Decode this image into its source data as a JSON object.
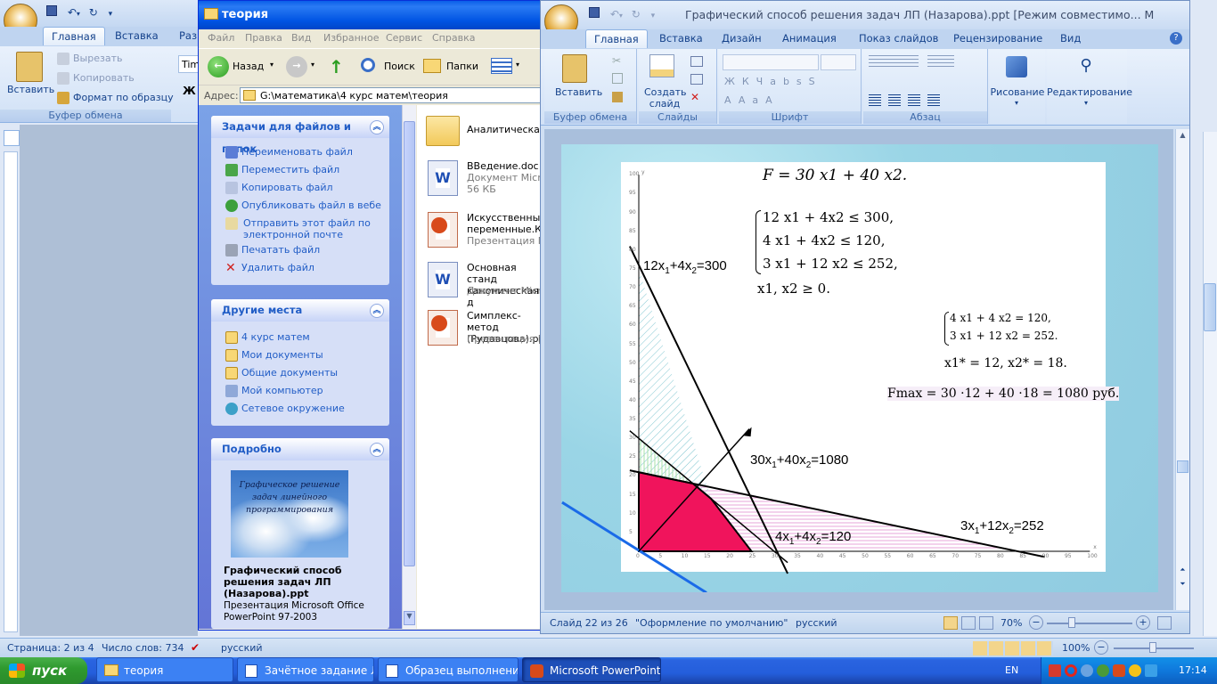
{
  "word": {
    "tabs": [
      "Главная",
      "Вставка",
      "Раз"
    ],
    "clipboard": {
      "paste": "Вставить",
      "cut": "Вырезать",
      "copy": "Копировать",
      "format_painter": "Формат по образцу",
      "group": "Буфер обмена"
    },
    "font_box": "Tim",
    "status": {
      "page": "Страница: 2 из 4",
      "words": "Число слов: 734",
      "lang": "русский",
      "zoom": "100%"
    }
  },
  "explorer": {
    "title": "теория",
    "menu": [
      "Файл",
      "Правка",
      "Вид",
      "Избранное",
      "Сервис",
      "Справка"
    ],
    "toolbar": {
      "back": "Назад",
      "search": "Поиск",
      "folders": "Папки"
    },
    "address_label": "Адрес:",
    "address": "G:\\математика\\4 курс матем\\теория",
    "tasks_panel": {
      "title": "Задачи для файлов и папок",
      "items": [
        "Переименовать файл",
        "Переместить файл",
        "Копировать файл",
        "Опубликовать файл в вебе",
        "Отправить этот файл по электронной почте",
        "Печатать файл",
        "Удалить файл"
      ]
    },
    "places_panel": {
      "title": "Другие места",
      "items": [
        "4 курс матем",
        "Мои документы",
        "Общие документы",
        "Мой компьютер",
        "Сетевое окружение"
      ]
    },
    "details_panel": {
      "title": "Подробно",
      "thumb_text": "Графическое решение задач линейного программирования",
      "name": "Графический способ решения задач ЛП (Назарова).ppt",
      "type": "Презентация Microsoft Office PowerPoint 97-2003"
    },
    "files": [
      {
        "name": "Аналитическая",
        "type": "",
        "size": ""
      },
      {
        "name": "ВВедение.doc",
        "type": "Документ Micros",
        "size": "56 КБ"
      },
      {
        "name": "Искусственные переменные.Кор",
        "type": "Презентация Mic",
        "size": ""
      },
      {
        "name": "Основная станд каноническая д",
        "type": "Документ Micros",
        "size": ""
      },
      {
        "name": "Симплекс-метод (Рудавцова).ppt",
        "type": "Презентация Mic",
        "size": ""
      }
    ]
  },
  "ppt": {
    "title": "Графический способ  решения задач ЛП (Назарова).ppt [Режим совместимо... М",
    "tabs": [
      "Главная",
      "Вставка",
      "Дизайн",
      "Анимация",
      "Показ слайдов",
      "Рецензирование",
      "Вид"
    ],
    "groups": {
      "paste": "Вставить",
      "clipboard": "Буфер обмена",
      "create_slide": "Создать слайд",
      "slides": "Слайды",
      "font": "Шрифт",
      "paragraph": "Абзац",
      "drawing": "Рисование",
      "editing": "Редактирование"
    },
    "status": {
      "slide": "Слайд 22 из 26",
      "theme": "\"Оформление по умолчанию\"",
      "lang": "русский",
      "zoom": "70%"
    }
  },
  "slide": {
    "objective": "F = 30 x1 + 40 x2.",
    "constraints": [
      "12 x1 + 4x2 ≤ 300,",
      "4 x1 + 4x2 ≤ 120,",
      "3 x1 + 12 x2 ≤ 252,",
      "x1, x2 ≥ 0."
    ],
    "system": [
      "4 x1 + 4 x2 = 120,",
      "3 x1 + 12 x2 = 252."
    ],
    "solution": "x1* = 12, x2* = 18.",
    "fmax": "Fmax = 30 ·12 + 40 ·18 = 1080 руб.",
    "line_labels": {
      "l1": "12x1+4x2=300",
      "l2": "30x1+40x2=1080",
      "l3": "4x1+4x2=120",
      "l4": "3x1+12x2=252"
    },
    "x_ticks": [
      "0",
      "5",
      "10",
      "15",
      "20",
      "25",
      "30",
      "35",
      "40",
      "45",
      "50",
      "55",
      "60",
      "65",
      "70",
      "75",
      "80",
      "85",
      "90",
      "95",
      "100"
    ],
    "y_ticks": [
      "100",
      "95",
      "90",
      "85",
      "80",
      "75",
      "70",
      "65",
      "60",
      "55",
      "50",
      "45",
      "40",
      "35",
      "30",
      "25",
      "20",
      "15",
      "10",
      "5"
    ],
    "axis_x": "x",
    "axis_y": "y"
  },
  "taskbar": {
    "start": "пуск",
    "buttons": [
      "теория",
      "Зачётное задание Л...",
      "Образец выполнени...",
      "Microsoft PowerPoint ..."
    ],
    "lang": "EN",
    "clock": "17:14"
  }
}
